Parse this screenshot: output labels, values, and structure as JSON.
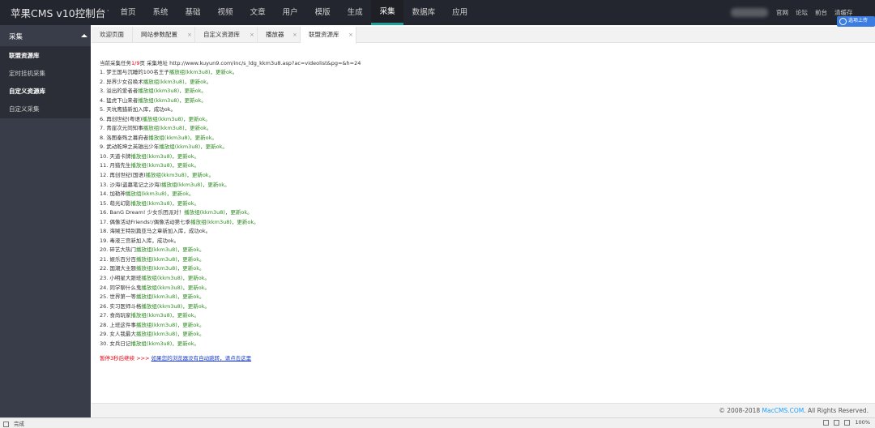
{
  "app": {
    "title": "苹果CMS v10控制台",
    "more_icon": "···"
  },
  "nav": [
    {
      "label": "首页"
    },
    {
      "label": "系统"
    },
    {
      "label": "基础"
    },
    {
      "label": "视频"
    },
    {
      "label": "文章"
    },
    {
      "label": "用户"
    },
    {
      "label": "模版"
    },
    {
      "label": "生成"
    },
    {
      "label": "采集",
      "active": true
    },
    {
      "label": "数据库"
    },
    {
      "label": "应用"
    }
  ],
  "right_links": [
    "官网",
    "论坛",
    "前台",
    "清缓存"
  ],
  "badge": {
    "label": "选项上传",
    "icon": "baidu-cloud-icon"
  },
  "sidebar": {
    "section": "采集",
    "items": [
      {
        "label": "联盟资源库",
        "bold": true
      },
      {
        "label": "定时挂机采集",
        "bold": false
      },
      {
        "label": "自定义资源库",
        "bold": true
      },
      {
        "label": "自定义采集",
        "bold": false
      }
    ]
  },
  "tabs": [
    {
      "label": "欢迎页面",
      "closable": false
    },
    {
      "label": "网站参数配置",
      "closable": true
    },
    {
      "label": "自定义资源库",
      "closable": true
    },
    {
      "label": "播放器",
      "closable": true
    },
    {
      "label": "联盟资源库",
      "closable": true,
      "active": true
    }
  ],
  "collect": {
    "header_prefix": "当前采集任务",
    "page_progress": "1/9",
    "header_mid": "页 采集地址 ",
    "url": "http://www.kuyun9.com/inc/s_ldg_kkm3u8.asp?ac=videolist&pg=&h=24",
    "lines": [
      {
        "num": "1.",
        "title": "梦王国与沉睡的100名王子",
        "action": "播放组(kkm3u8)，更新ok。"
      },
      {
        "num": "2.",
        "title": "异界少女召唤术",
        "action": "播放组(kkm3u8)，更新ok。"
      },
      {
        "num": "3.",
        "title": "溢出的爱者者",
        "action": "播放组(kkm3u8)，更新ok。"
      },
      {
        "num": "4.",
        "title": "猛虎下山来者",
        "action": "播放组(kkm3u8)，更新ok。"
      },
      {
        "num": "5.",
        "title": "天坑鹰猎新加入库，成功ok。",
        "action": ""
      },
      {
        "num": "6.",
        "title": "再创世纪(粤语)",
        "action": "播放组(kkm3u8)，更新ok。"
      },
      {
        "num": "7.",
        "title": "青崖次元同知事",
        "action": "播放组(kkm3u8)，更新ok。"
      },
      {
        "num": "8.",
        "title": "洛图秦殇之幕府者",
        "action": "播放组(kkm3u8)，更新ok。"
      },
      {
        "num": "9.",
        "title": "武动乾坤之英雄出少年",
        "action": "播放组(kkm3u8)，更新ok。"
      },
      {
        "num": "10.",
        "title": "天道卡牌",
        "action": "播放组(kkm3u8)，更新ok。"
      },
      {
        "num": "11.",
        "title": "月猎先生",
        "action": "播放组(kkm3u8)，更新ok。"
      },
      {
        "num": "12.",
        "title": "再创世纪(国语)",
        "action": "播放组(kkm3u8)，更新ok。"
      },
      {
        "num": "13.",
        "title": "沙海(盗墓笔记之沙海)",
        "action": "播放组(kkm3u8)，更新ok。"
      },
      {
        "num": "14.",
        "title": "加勒神",
        "action": "播放组(kkm3u8)，更新ok。"
      },
      {
        "num": "15.",
        "title": "萌光幻影",
        "action": "播放组(kkm3u8)，更新ok。"
      },
      {
        "num": "16.",
        "title": "BanG Dream! 少女乐团派对！",
        "action": "播放组(kkm3u8)，更新ok。"
      },
      {
        "num": "17.",
        "title": "偶像活动Friends!/偶像活动第七季",
        "action": "播放组(kkm3u8)，更新ok。"
      },
      {
        "num": "18.",
        "title": "海贼王特别篇亚马之章新加入库，成功ok。",
        "action": ""
      },
      {
        "num": "19.",
        "title": "毒液三宫新加入库，成功ok。",
        "action": ""
      },
      {
        "num": "20.",
        "title": "碎艺大热门",
        "action": "播放组(kkm3u8)，更新ok。"
      },
      {
        "num": "21.",
        "title": "娱乐百分百",
        "action": "播放组(kkm3u8)，更新ok。"
      },
      {
        "num": "22.",
        "title": "国潮大主题",
        "action": "播放组(kkm3u8)，更新ok。"
      },
      {
        "num": "23.",
        "title": "小明星大跟班",
        "action": "播放组(kkm3u8)，更新ok。"
      },
      {
        "num": "24.",
        "title": "同学聊什么鬼",
        "action": "播放组(kkm3u8)，更新ok。"
      },
      {
        "num": "25.",
        "title": "世界第一等",
        "action": "播放组(kkm3u8)，更新ok。"
      },
      {
        "num": "26.",
        "title": "实习医师斗格",
        "action": "播放组(kkm3u8)，更新ok。"
      },
      {
        "num": "27.",
        "title": "食尚玩家",
        "action": "播放组(kkm3u8)，更新ok。"
      },
      {
        "num": "28.",
        "title": "上班这件事",
        "action": "播放组(kkm3u8)，更新ok。"
      },
      {
        "num": "29.",
        "title": "女人我最大",
        "action": "播放组(kkm3u8)，更新ok。"
      },
      {
        "num": "30.",
        "title": "女兵日记",
        "action": "播放组(kkm3u8)，更新ok。"
      }
    ],
    "footer_warn": "暂停3秒后继续 >>> ",
    "footer_link": "如果您的浏览器没有自动跳转，请点击这里"
  },
  "copyright": {
    "prefix": "© 2008-2018 ",
    "brand": "MacCMS.COM",
    "suffix": ". All Rights Reserved."
  },
  "statusbar": {
    "left": "完成",
    "zoom": "100%"
  }
}
